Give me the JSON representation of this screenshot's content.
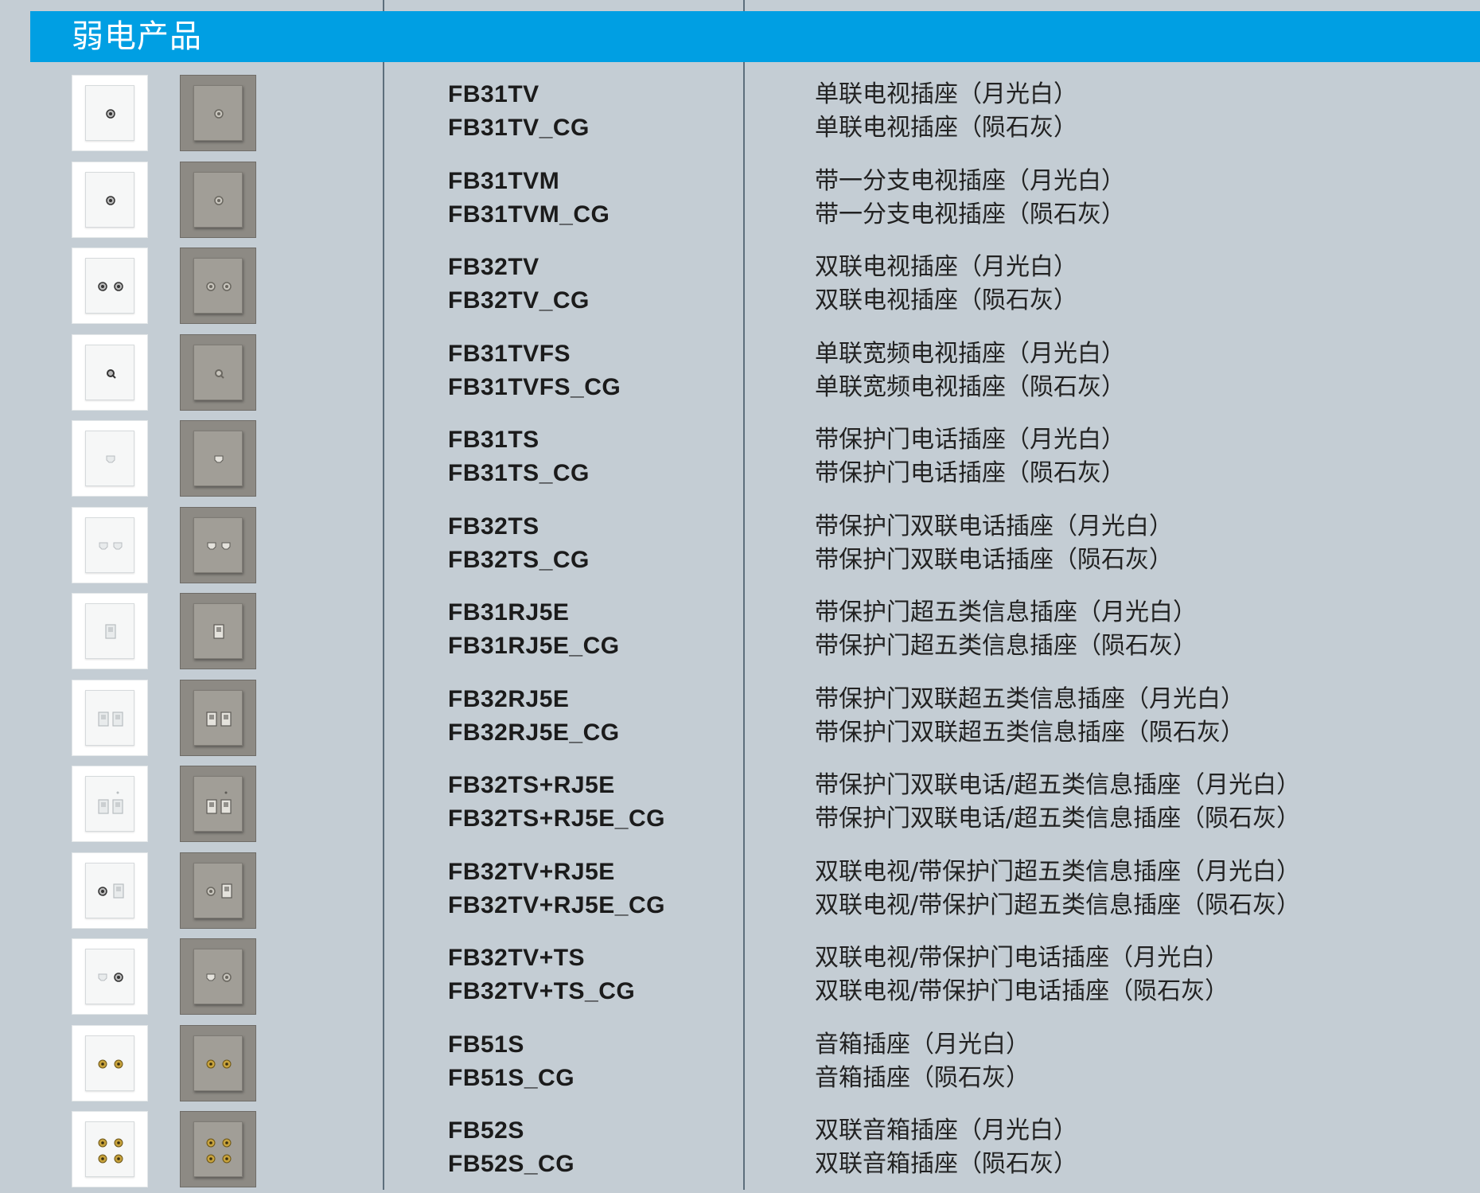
{
  "section": {
    "title": "弱电产品"
  },
  "products": [
    {
      "icon": "tv-socket-icon",
      "codes": [
        "FB31TV",
        "FB31TV_CG"
      ],
      "names": [
        "单联电视插座（月光白）",
        "单联电视插座（陨石灰）"
      ]
    },
    {
      "icon": "tv-socket-icon",
      "codes": [
        "FB31TVM",
        "FB31TVM_CG"
      ],
      "names": [
        "带一分支电视插座（月光白）",
        "带一分支电视插座（陨石灰）"
      ]
    },
    {
      "icon": "double-tv-socket-icon",
      "codes": [
        "FB32TV",
        "FB32TV_CG"
      ],
      "names": [
        "双联电视插座（月光白）",
        "双联电视插座（陨石灰）"
      ]
    },
    {
      "icon": "wideband-tv-socket-icon",
      "codes": [
        "FB31TVFS",
        "FB31TVFS_CG"
      ],
      "names": [
        "单联宽频电视插座（月光白）",
        "单联宽频电视插座（陨石灰）"
      ]
    },
    {
      "icon": "phone-socket-icon",
      "codes": [
        "FB31TS",
        "FB31TS_CG"
      ],
      "names": [
        "带保护门电话插座（月光白）",
        "带保护门电话插座（陨石灰）"
      ]
    },
    {
      "icon": "double-phone-socket-icon",
      "codes": [
        "FB32TS",
        "FB32TS_CG"
      ],
      "names": [
        "带保护门双联电话插座（月光白）",
        "带保护门双联电话插座（陨石灰）"
      ]
    },
    {
      "icon": "network-socket-icon",
      "codes": [
        "FB31RJ5E",
        "FB31RJ5E_CG"
      ],
      "names": [
        "带保护门超五类信息插座（月光白）",
        "带保护门超五类信息插座（陨石灰）"
      ]
    },
    {
      "icon": "double-network-socket-icon",
      "codes": [
        "FB32RJ5E",
        "FB32RJ5E_CG"
      ],
      "names": [
        "带保护门双联超五类信息插座（月光白）",
        "带保护门双联超五类信息插座（陨石灰）"
      ]
    },
    {
      "icon": "phone-network-socket-icon",
      "codes": [
        "FB32TS+RJ5E",
        "FB32TS+RJ5E_CG"
      ],
      "names": [
        "带保护门双联电话/超五类信息插座（月光白）",
        "带保护门双联电话/超五类信息插座（陨石灰）"
      ]
    },
    {
      "icon": "tv-network-socket-icon",
      "codes": [
        "FB32TV+RJ5E",
        "FB32TV+RJ5E_CG"
      ],
      "names": [
        "双联电视/带保护门超五类信息插座（月光白）",
        "双联电视/带保护门超五类信息插座（陨石灰）"
      ]
    },
    {
      "icon": "phone-tv-socket-icon",
      "codes": [
        "FB32TV+TS",
        "FB32TV+TS_CG"
      ],
      "names": [
        "双联电视/带保护门电话插座（月光白）",
        "双联电视/带保护门电话插座（陨石灰）"
      ]
    },
    {
      "icon": "speaker-socket-icon",
      "codes": [
        "FB51S",
        "FB51S_CG"
      ],
      "names": [
        "音箱插座（月光白）",
        "音箱插座（陨石灰）"
      ]
    },
    {
      "icon": "double-speaker-socket-icon",
      "codes": [
        "FB52S",
        "FB52S_CG"
      ],
      "names": [
        "双联音箱插座（月光白）",
        "双联音箱插座（陨石灰）"
      ]
    }
  ],
  "colors": {
    "header": "#009fe3",
    "background": "#c4cdd4",
    "moonlight_white": "#ffffff",
    "meteorite_grey": "#8d8a84"
  }
}
